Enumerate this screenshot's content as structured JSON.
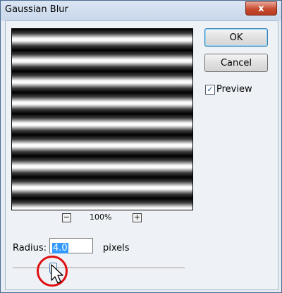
{
  "window": {
    "title": "Gaussian Blur",
    "close_label": "x"
  },
  "buttons": {
    "ok": "OK",
    "cancel": "Cancel"
  },
  "preview": {
    "label": "Preview",
    "checked": true,
    "check_glyph": "✓"
  },
  "zoom": {
    "minus": "−",
    "level": "100%",
    "plus": "+"
  },
  "radius": {
    "label": "Radius:",
    "value": "4.0",
    "unit": "pixels"
  },
  "slider": {
    "value": 4.0
  },
  "colors": {
    "annotation": "#e01010",
    "selection": "#3399ff",
    "accent": "#3c7fb1"
  }
}
